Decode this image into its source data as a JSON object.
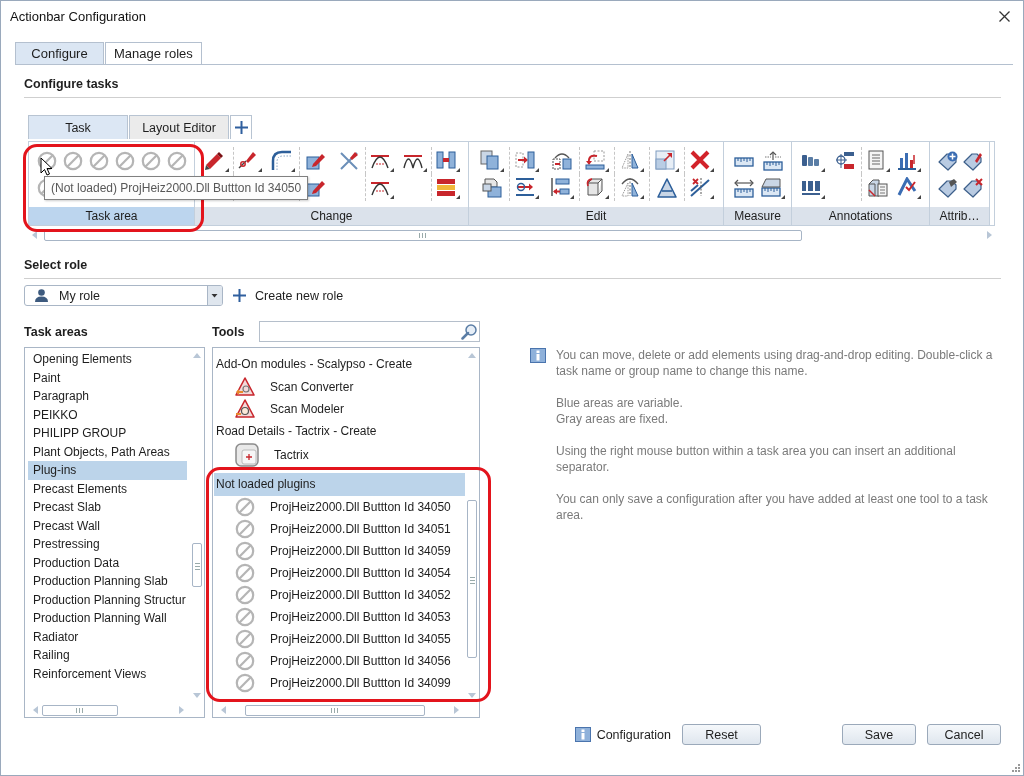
{
  "window": {
    "title": "Actionbar Configuration"
  },
  "tabs": [
    {
      "label": "Configure",
      "selected": true
    },
    {
      "label": "Manage roles",
      "selected": false
    }
  ],
  "configure_tasks": {
    "heading": "Configure tasks",
    "task_tabs": [
      {
        "label": "Task",
        "selected": true
      },
      {
        "label": "Layout Editor",
        "selected": false
      }
    ],
    "ribbon": {
      "groups": [
        {
          "label": "Task area",
          "variable": true,
          "highlighted": true
        },
        {
          "label": "Change",
          "variable": false,
          "highlighted": false
        },
        {
          "label": "Edit",
          "variable": false,
          "highlighted": false
        },
        {
          "label": "Measure",
          "variable": false,
          "highlighted": false
        },
        {
          "label": "Annotations",
          "variable": false,
          "highlighted": false
        },
        {
          "label": "Attrib…",
          "variable": false,
          "highlighted": false
        }
      ]
    },
    "tooltip": "(Not loaded) ProjHeiz2000.Dll Buttton Id 34050"
  },
  "select_role": {
    "heading": "Select role",
    "role": "My role",
    "create_button": "Create new role"
  },
  "task_areas": {
    "heading": "Task areas",
    "items": [
      {
        "label": "Opening Elements",
        "selected": false
      },
      {
        "label": "Paint",
        "selected": false
      },
      {
        "label": "Paragraph",
        "selected": false
      },
      {
        "label": "PEIKKO",
        "selected": false
      },
      {
        "label": "PHILIPP GROUP",
        "selected": false
      },
      {
        "label": "Plant Objects, Path Areas",
        "selected": false
      },
      {
        "label": "Plug-ins",
        "selected": true
      },
      {
        "label": "Precast Elements",
        "selected": false
      },
      {
        "label": "Precast Slab",
        "selected": false
      },
      {
        "label": "Precast Wall",
        "selected": false
      },
      {
        "label": "Prestressing",
        "selected": false
      },
      {
        "label": "Production Data",
        "selected": false
      },
      {
        "label": "Production Planning Slab",
        "selected": false
      },
      {
        "label": "Production Planning Structur",
        "selected": false
      },
      {
        "label": "Production Planning Wall",
        "selected": false
      },
      {
        "label": "Radiator",
        "selected": false
      },
      {
        "label": "Railing",
        "selected": false
      },
      {
        "label": "Reinforcement Views",
        "selected": false
      }
    ]
  },
  "tools": {
    "heading": "Tools",
    "groups": [
      {
        "title": "Add-On modules - Scalypso - Create",
        "selected": false,
        "highlighted": false,
        "items": [
          {
            "label": "Scan Converter",
            "loaded": true
          },
          {
            "label": "Scan Modeler",
            "loaded": true
          }
        ]
      },
      {
        "title": "Road Details - Tactrix - Create",
        "selected": false,
        "highlighted": false,
        "items": [
          {
            "label": "Tactrix",
            "loaded": true
          }
        ]
      },
      {
        "title": "Not loaded plugins",
        "selected": true,
        "highlighted": true,
        "items": [
          {
            "label": "ProjHeiz2000.Dll Buttton Id 34050",
            "loaded": false
          },
          {
            "label": "ProjHeiz2000.Dll Buttton Id 34051",
            "loaded": false
          },
          {
            "label": "ProjHeiz2000.Dll Buttton Id 34059",
            "loaded": false
          },
          {
            "label": "ProjHeiz2000.Dll Buttton Id 34054",
            "loaded": false
          },
          {
            "label": "ProjHeiz2000.Dll Buttton Id 34052",
            "loaded": false
          },
          {
            "label": "ProjHeiz2000.Dll Buttton Id 34053",
            "loaded": false
          },
          {
            "label": "ProjHeiz2000.Dll Buttton Id 34055",
            "loaded": false
          },
          {
            "label": "ProjHeiz2000.Dll Buttton Id 34056",
            "loaded": false
          },
          {
            "label": "ProjHeiz2000.Dll Buttton Id 34099",
            "loaded": false
          }
        ]
      }
    ]
  },
  "info": {
    "paragraphs": [
      "You can move, delete or add elements using drag-and-drop editing. Double-click a task name or group name to change this name.",
      "Blue areas are variable.\nGray areas are fixed.",
      "Using the right mouse button within a task area you can insert an additional separator.",
      "You can only save a configuration after you have added at least one tool to a task area."
    ]
  },
  "footer": {
    "info_label": "Configuration",
    "reset": "Reset",
    "buttons": [
      "Save",
      "Cancel"
    ]
  }
}
